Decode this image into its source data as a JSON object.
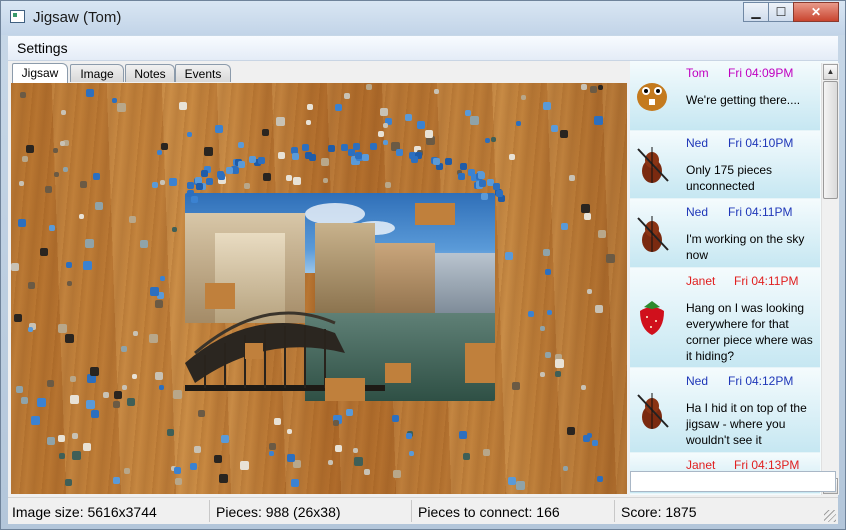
{
  "window": {
    "title": "Jigsaw (Tom)",
    "buttons": {
      "minimize_icon": "minimize-icon",
      "maximize_icon": "maximize-icon",
      "close_icon": "close-icon"
    }
  },
  "menu": {
    "settings_label": "Settings"
  },
  "tabs": [
    {
      "label": "Jigsaw",
      "active": true
    },
    {
      "label": "Image",
      "active": false
    },
    {
      "label": "Notes",
      "active": false
    },
    {
      "label": "Events",
      "active": false
    }
  ],
  "chat": {
    "messages": [
      {
        "name": "Tom",
        "time": "Fri 04:09PM",
        "text": "We're getting there....",
        "color": "#c000c0",
        "avatar": "beaver-avatar"
      },
      {
        "name": "Ned",
        "time": "Fri 04:10PM",
        "text": "Only 175 pieces unconnected",
        "color": "#1f37b8",
        "avatar": "violin-avatar"
      },
      {
        "name": "Ned",
        "time": "Fri 04:11PM",
        "text": "I'm working on the sky now",
        "color": "#1f37b8",
        "avatar": "violin-avatar"
      },
      {
        "name": "Janet",
        "time": "Fri 04:11PM",
        "text": "Hang on I was looking everywhere for that corner piece where was it hiding?",
        "color": "#e02020",
        "avatar": "strawberry-avatar"
      },
      {
        "name": "Ned",
        "time": "Fri 04:12PM",
        "text": "Ha I hid it on top of the jigsaw - where you wouldn't see it",
        "color": "#1f37b8",
        "avatar": "violin-avatar"
      },
      {
        "name": "Janet",
        "time": "Fri 04:13PM",
        "text": "",
        "color": "#e02020",
        "avatar": "strawberry-avatar"
      }
    ],
    "input_value": ""
  },
  "status": {
    "image_size": "Image size: 5616x3744",
    "pieces": "Pieces: 988 (26x38)",
    "to_connect": "Pieces to connect: 166",
    "score": "Score: 1875"
  }
}
